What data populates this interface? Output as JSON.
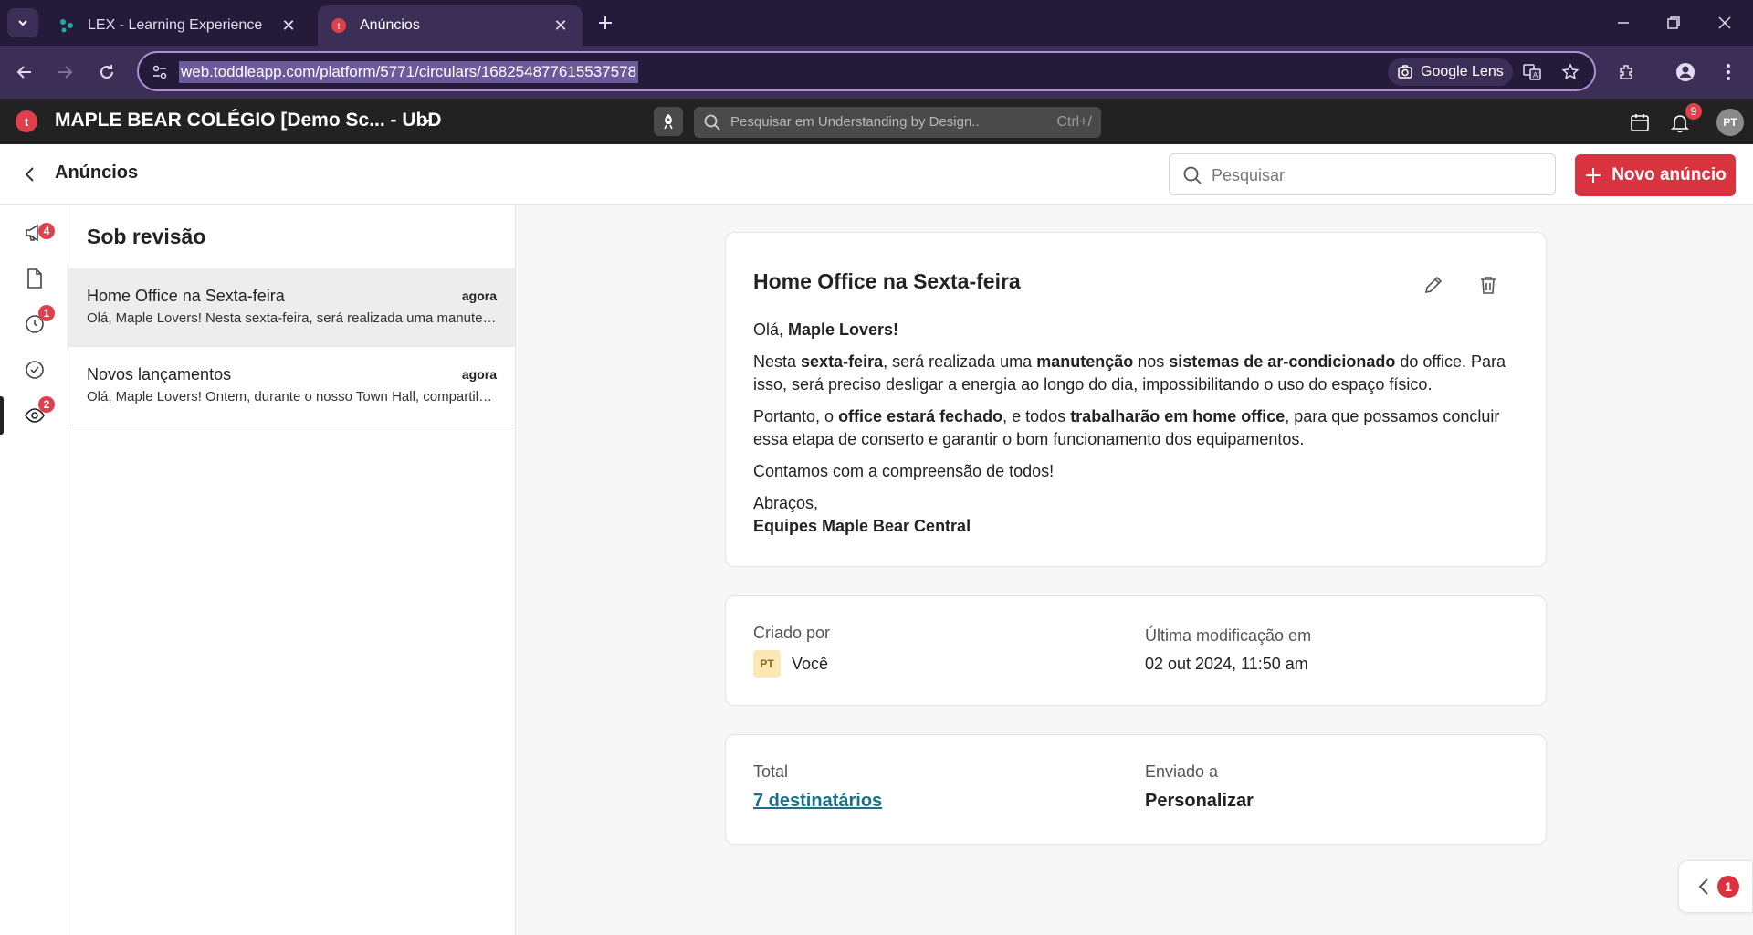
{
  "browser": {
    "tabs": [
      {
        "title": "LEX - Learning Experience",
        "active": false
      },
      {
        "title": "Anúncios",
        "active": true
      }
    ],
    "url": "web.toddleapp.com/platform/5771/circulars/168254877615537578",
    "lens_label": "Google Lens"
  },
  "app": {
    "org_name": "MAPLE BEAR COLÉGIO [Demo Sc... - UbD",
    "search_placeholder": "Pesquisar em Understanding by Design..",
    "search_shortcut": "Ctrl+/",
    "notifications_count": "9",
    "user_initials": "PT"
  },
  "page": {
    "title": "Anúncios",
    "search_placeholder": "Pesquisar",
    "new_button": "Novo anúncio"
  },
  "rail": {
    "items": [
      {
        "icon": "megaphone-icon",
        "badge": "4"
      },
      {
        "icon": "document-icon",
        "badge": ""
      },
      {
        "icon": "clock-icon",
        "badge": "1"
      },
      {
        "icon": "check-circle-icon",
        "badge": ""
      },
      {
        "icon": "review-icon",
        "badge": "2"
      }
    ]
  },
  "list": {
    "title": "Sob revisão",
    "items": [
      {
        "title": "Home Office na Sexta-feira",
        "time": "agora",
        "snippet": "Olá, Maple Lovers! Nesta sexta-feira, será realizada uma manutenção nos sistemas de ar-condicionado"
      },
      {
        "title": "Novos lançamentos",
        "time": "agora",
        "snippet": "Olá, Maple Lovers! Ontem, durante o nosso Town Hall, compartilhamos as novidades"
      }
    ]
  },
  "message": {
    "title": "Home Office na Sexta-feira",
    "greeting_prefix": "Olá, ",
    "greeting_bold": "Maple Lovers!",
    "p1": [
      "Nesta ",
      "sexta-feira",
      ", será realizada uma ",
      "manutenção",
      " nos ",
      "sistemas de ar-condicionado",
      " do office. Para isso, será preciso desligar a energia ao longo do dia, impossibilitando o uso do espaço físico."
    ],
    "p2": [
      "Portanto, o ",
      "office estará fechado",
      ", e todos ",
      "trabalharão em home office",
      ", para que possamos concluir essa etapa de conserto e garantir o bom funcionamento dos equipamentos."
    ],
    "p3": "Contamos com a compreensão de todos!",
    "sign_off": "Abraços,",
    "signature": "Equipes Maple Bear Central"
  },
  "meta": {
    "created_by_label": "Criado por",
    "creator_initials": "PT",
    "creator_name": "Você",
    "modified_label": "Última modificação em",
    "modified_value": "02 out 2024, 11:50 am"
  },
  "recipients": {
    "total_label": "Total",
    "total_value": "7 destinatários",
    "sent_to_label": "Enviado a",
    "sent_to_value": "Personalizar"
  },
  "floating": {
    "badge": "1"
  },
  "colors": {
    "brand_red": "#d8333f",
    "link": "#1b6f87",
    "chrome": "#3b2f57"
  }
}
